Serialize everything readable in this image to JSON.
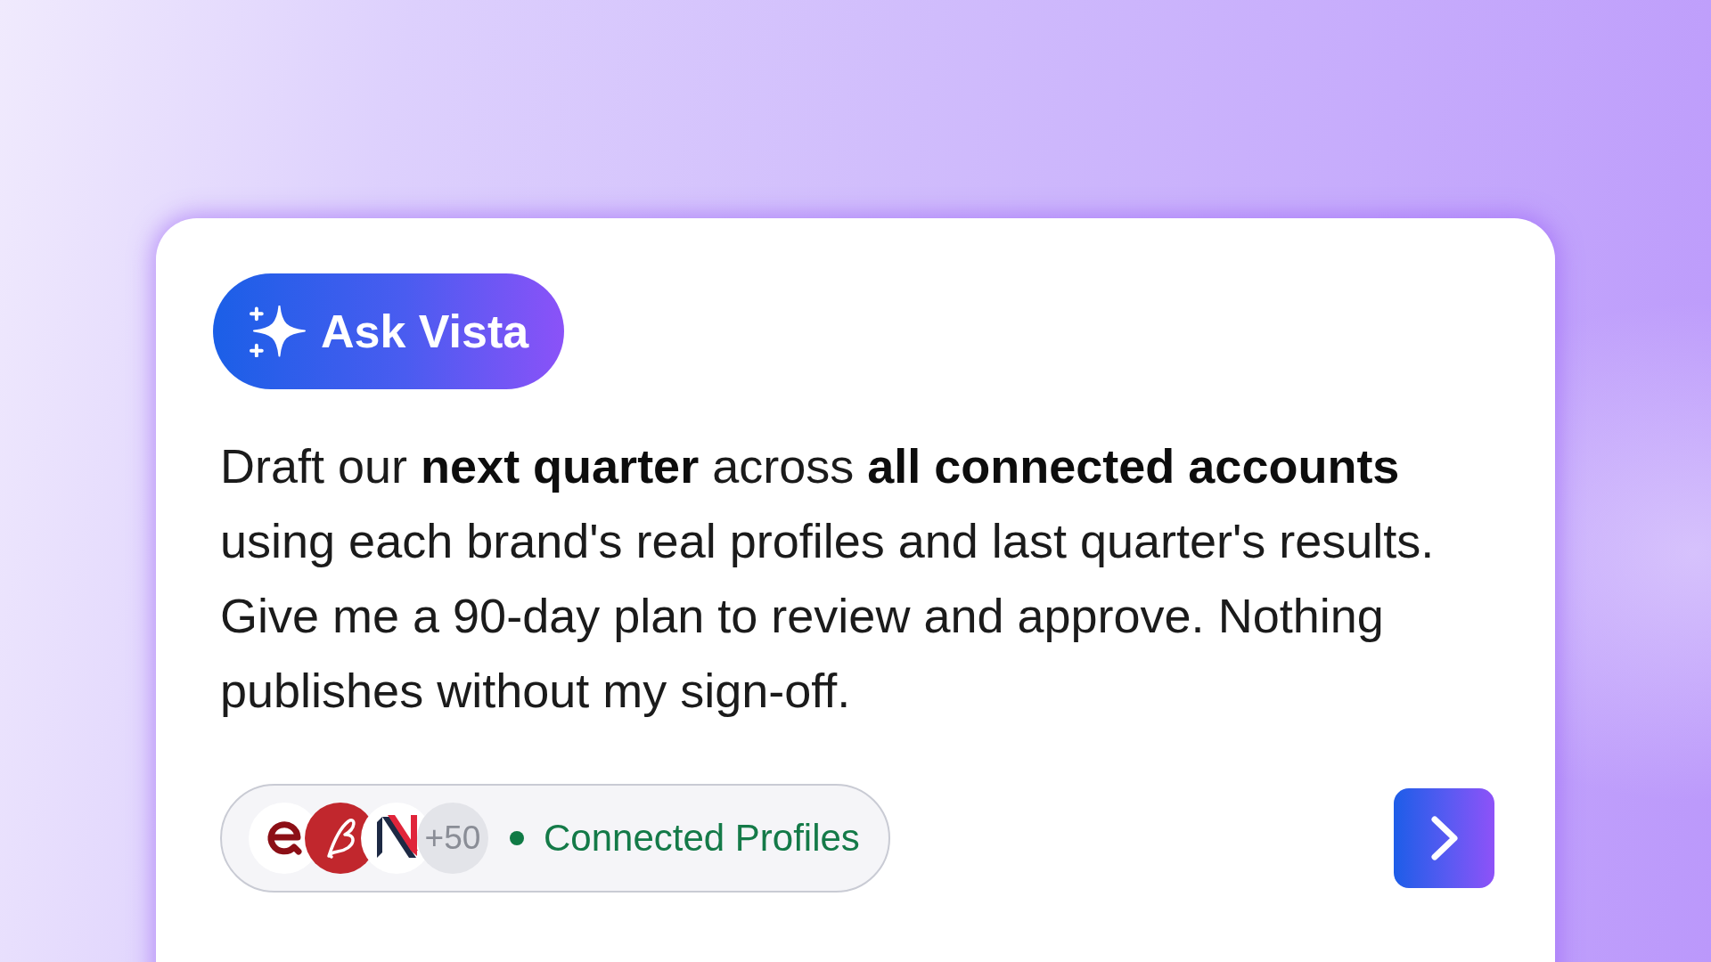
{
  "assistant_button": {
    "label": "Ask Vista"
  },
  "prompt": {
    "text": "Draft our **next quarter** across **all connected accounts** using each brand's real profiles and last quarter's results. Give me a 90-day plan to review and approve. Nothing publishes without my sign-off."
  },
  "profiles": {
    "avatars": [
      {
        "kind": "swirl"
      },
      {
        "kind": "script"
      },
      {
        "kind": "stripes"
      }
    ],
    "more_count": "+50",
    "status": "Connected Profiles"
  }
}
